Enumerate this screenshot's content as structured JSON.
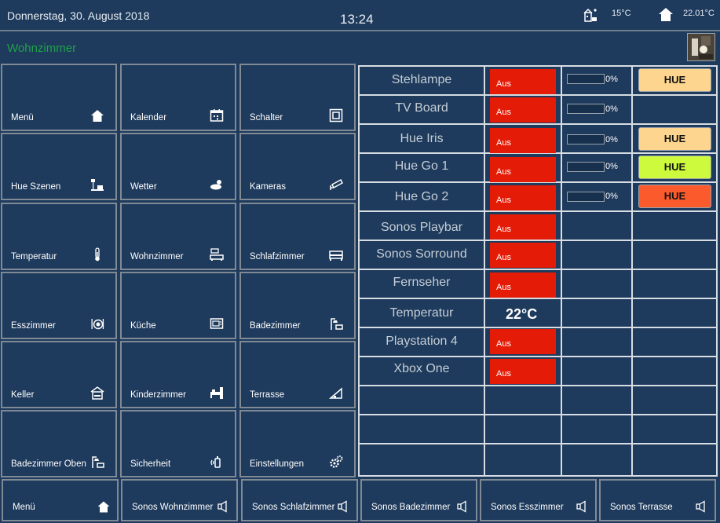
{
  "header": {
    "date": "Donnerstag, 30. August 2018",
    "time": "13:24",
    "outdoor_temp": "15°C",
    "indoor_temp": "22.01°C"
  },
  "room": {
    "title": "Wohnzimmer"
  },
  "tiles": [
    {
      "label": "Menü",
      "icon": "home-icon"
    },
    {
      "label": "Kalender",
      "icon": "calendar-icon"
    },
    {
      "label": "Schalter",
      "icon": "switch-icon"
    },
    {
      "label": "Hue Szenen",
      "icon": "lamp-icon"
    },
    {
      "label": "Wetter",
      "icon": "weather-icon"
    },
    {
      "label": "Kameras",
      "icon": "camera-icon"
    },
    {
      "label": "Temperatur",
      "icon": "thermometer-icon"
    },
    {
      "label": "Wohnzimmer",
      "icon": "sofa-icon"
    },
    {
      "label": "Schlafzimmer",
      "icon": "bed-icon"
    },
    {
      "label": "Esszimmer",
      "icon": "dining-icon"
    },
    {
      "label": "Küche",
      "icon": "kitchen-icon"
    },
    {
      "label": "Badezimmer",
      "icon": "shower-icon"
    },
    {
      "label": "Keller",
      "icon": "basement-icon"
    },
    {
      "label": "Kinderzimmer",
      "icon": "kids-bed-icon"
    },
    {
      "label": "Terrasse",
      "icon": "terrace-icon"
    },
    {
      "label": "Badezimmer Oben",
      "icon": "shower-icon"
    },
    {
      "label": "Sicherheit",
      "icon": "alarm-icon"
    },
    {
      "label": "Einstellungen",
      "icon": "gears-icon"
    }
  ],
  "devices": [
    {
      "name": "Stehlampe",
      "state": "Aus",
      "dim_label": "0%",
      "dim_level": 0,
      "hue_label": "HUE",
      "hue_color": "#fdd58e"
    },
    {
      "name": "TV Board",
      "state": "Aus",
      "dim_label": "0%",
      "dim_level": 0
    },
    {
      "name": "Hue Iris",
      "state": "Aus",
      "dim_label": "0%",
      "dim_level": 0,
      "hue_label": "HUE",
      "hue_color": "#fdd58e"
    },
    {
      "name": "Hue Go 1",
      "state": "Aus",
      "dim_label": "0%",
      "dim_level": 0,
      "hue_label": "HUE",
      "hue_color": "#cdfa3c"
    },
    {
      "name": "Hue Go 2",
      "state": "Aus",
      "dim_label": "0%",
      "dim_level": 0,
      "hue_label": "HUE",
      "hue_color": "#fb5a2c"
    },
    {
      "name": "Sonos Playbar",
      "state": "Aus"
    },
    {
      "name": "Sonos Sorround",
      "state": "Aus"
    },
    {
      "name": "Fernseher",
      "state": "Aus"
    },
    {
      "name": "Temperatur",
      "value": "22°C"
    },
    {
      "name": "Playstation 4",
      "state": "Aus"
    },
    {
      "name": "Xbox One",
      "state": "Aus"
    }
  ],
  "bottom_bar": [
    {
      "label": "Menü",
      "icon": "home-icon"
    },
    {
      "label": "Sonos Wohnzimmer",
      "icon": "speaker-icon"
    },
    {
      "label": "Sonos Schlafzimmer",
      "icon": "speaker-icon"
    },
    {
      "label": "Sonos Badezimmer",
      "icon": "speaker-icon"
    },
    {
      "label": "Sonos Esszimmer",
      "icon": "speaker-icon"
    },
    {
      "label": "Sonos Terrasse",
      "icon": "speaker-icon"
    }
  ],
  "colors": {
    "background": "#1e3a5c",
    "off_state": "#e41b06",
    "room_title": "#1ea24a",
    "grid_line": "#d7dde2"
  }
}
